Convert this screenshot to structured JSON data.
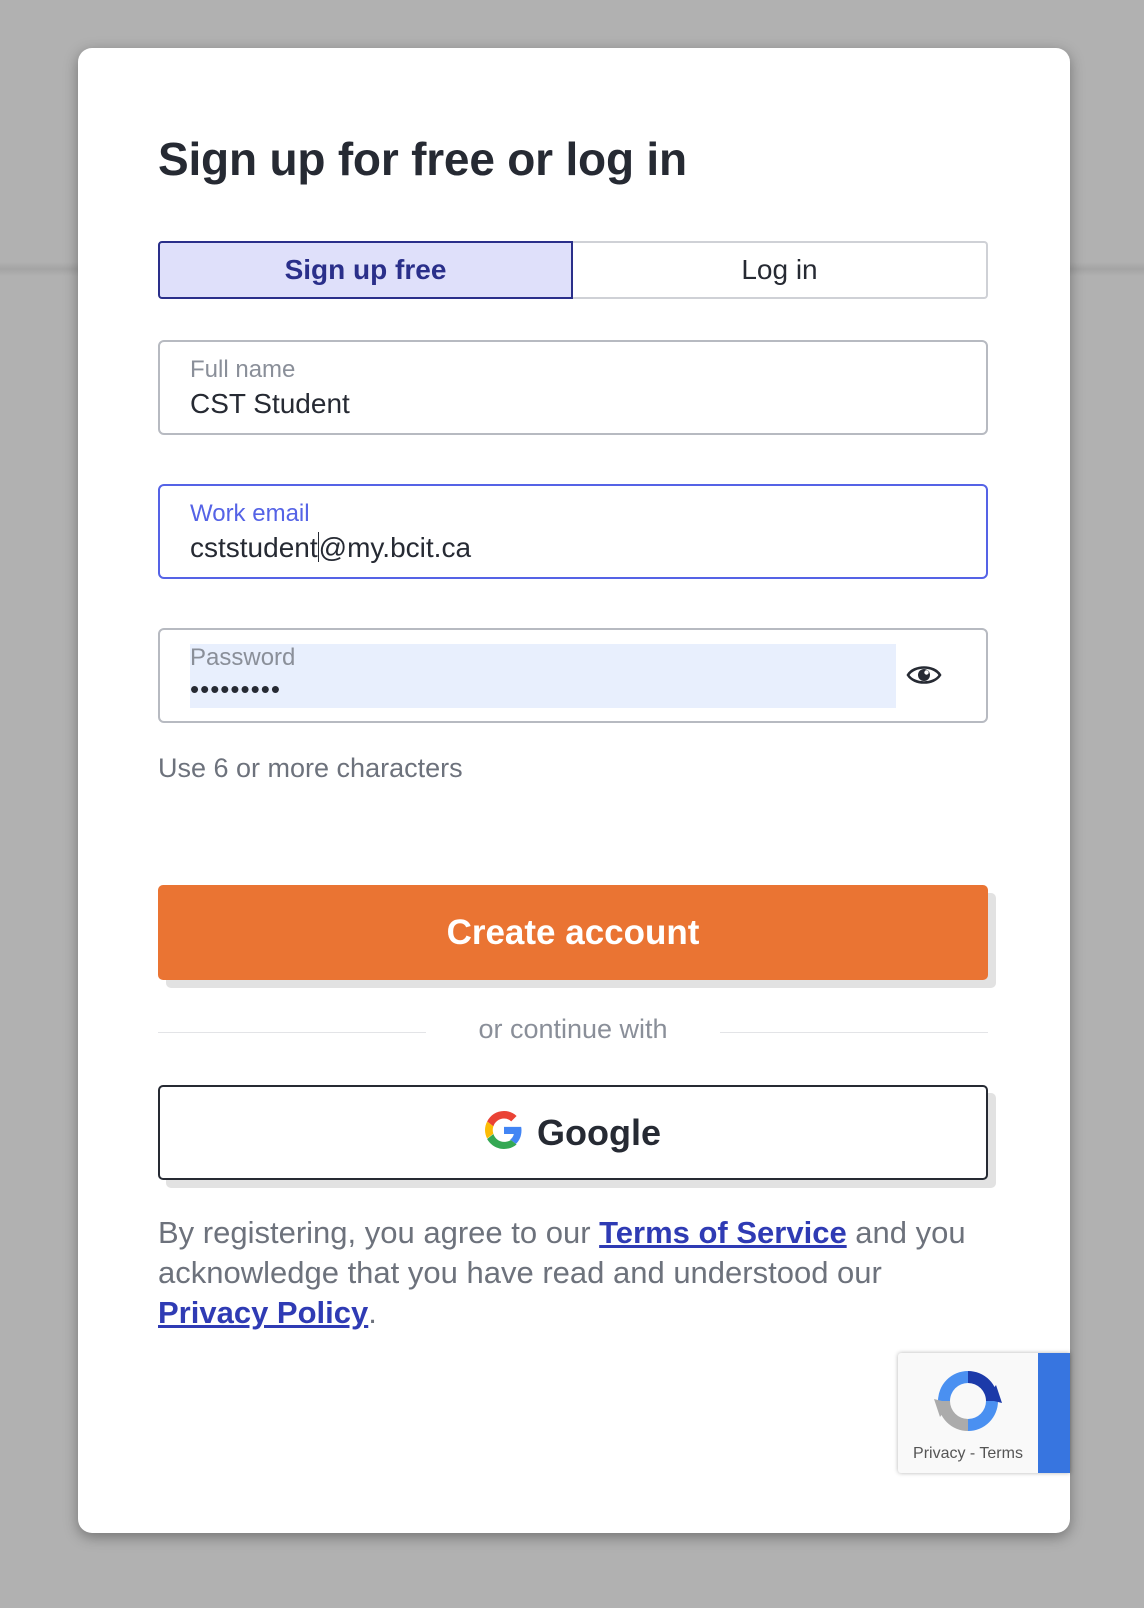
{
  "modal": {
    "title": "Sign up for free or log in"
  },
  "tabs": [
    {
      "label": "Sign up free",
      "active": true
    },
    {
      "label": "Log in",
      "active": false
    }
  ],
  "form": {
    "full_name": {
      "label": "Full name",
      "value": "CST Student"
    },
    "email": {
      "label": "Work email",
      "value_before_caret": "cststudent",
      "value_after_caret": "@my.bcit.ca"
    },
    "password": {
      "label": "Password",
      "value": "•••••••••",
      "toggle_icon": "eye-icon"
    },
    "password_hint": "Use 6 or more characters"
  },
  "actions": {
    "create_account": "Create account",
    "divider": "or continue with",
    "google": "Google",
    "google_icon": "google-g-icon"
  },
  "legal": {
    "prefix": "By registering, you agree to our ",
    "terms": "Terms of Service",
    "middle": " and you acknowledge that you have read and understood our ",
    "privacy": "Privacy Policy",
    "suffix": "."
  },
  "recaptcha": {
    "privacy": "Privacy",
    "separator": " - ",
    "terms": "Terms",
    "icon": "recaptcha-icon"
  },
  "colors": {
    "accent": "#ea7433",
    "tab_active_bg": "#dfe0fa",
    "tab_active_text": "#2a2f8a",
    "focus": "#5563e6",
    "link": "#2f3bb4",
    "backdrop": "#b1b1b1",
    "recaptcha_blue": "#3775e0"
  }
}
